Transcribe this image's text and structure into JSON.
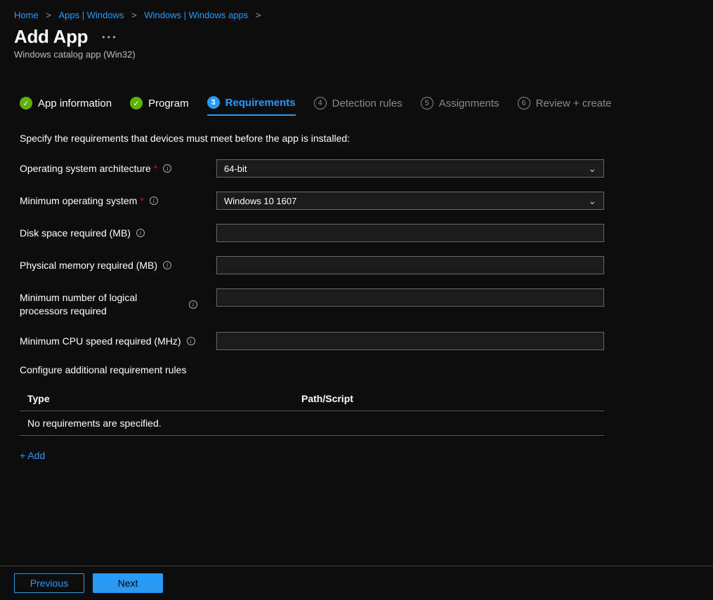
{
  "breadcrumb": {
    "items": [
      "Home",
      "Apps | Windows",
      "Windows | Windows apps"
    ]
  },
  "header": {
    "title": "Add App",
    "subtitle": "Windows catalog app (Win32)"
  },
  "tabs": [
    {
      "label": "App information",
      "state": "done"
    },
    {
      "label": "Program",
      "state": "done"
    },
    {
      "label": "Requirements",
      "state": "active",
      "num": "3"
    },
    {
      "label": "Detection rules",
      "state": "pending",
      "num": "4"
    },
    {
      "label": "Assignments",
      "state": "pending",
      "num": "5"
    },
    {
      "label": "Review + create",
      "state": "pending",
      "num": "6"
    }
  ],
  "instruction": "Specify the requirements that devices must meet before the app is installed:",
  "fields": {
    "os_arch": {
      "label": "Operating system architecture",
      "value": "64-bit",
      "required": true,
      "type": "select"
    },
    "min_os": {
      "label": "Minimum operating system",
      "value": "Windows 10 1607",
      "required": true,
      "type": "select"
    },
    "disk": {
      "label": "Disk space required (MB)",
      "value": "",
      "required": false,
      "type": "text"
    },
    "mem": {
      "label": "Physical memory required (MB)",
      "value": "",
      "required": false,
      "type": "text"
    },
    "cpu_count": {
      "label": "Minimum number of logical processors required",
      "value": "",
      "required": false,
      "type": "text"
    },
    "cpu_speed": {
      "label": "Minimum CPU speed required (MHz)",
      "value": "",
      "required": false,
      "type": "text"
    }
  },
  "rules": {
    "heading": "Configure additional requirement rules",
    "cols": {
      "c1": "Type",
      "c2": "Path/Script"
    },
    "empty": "No requirements are specified.",
    "add": "+ Add"
  },
  "footer": {
    "prev": "Previous",
    "next": "Next"
  }
}
